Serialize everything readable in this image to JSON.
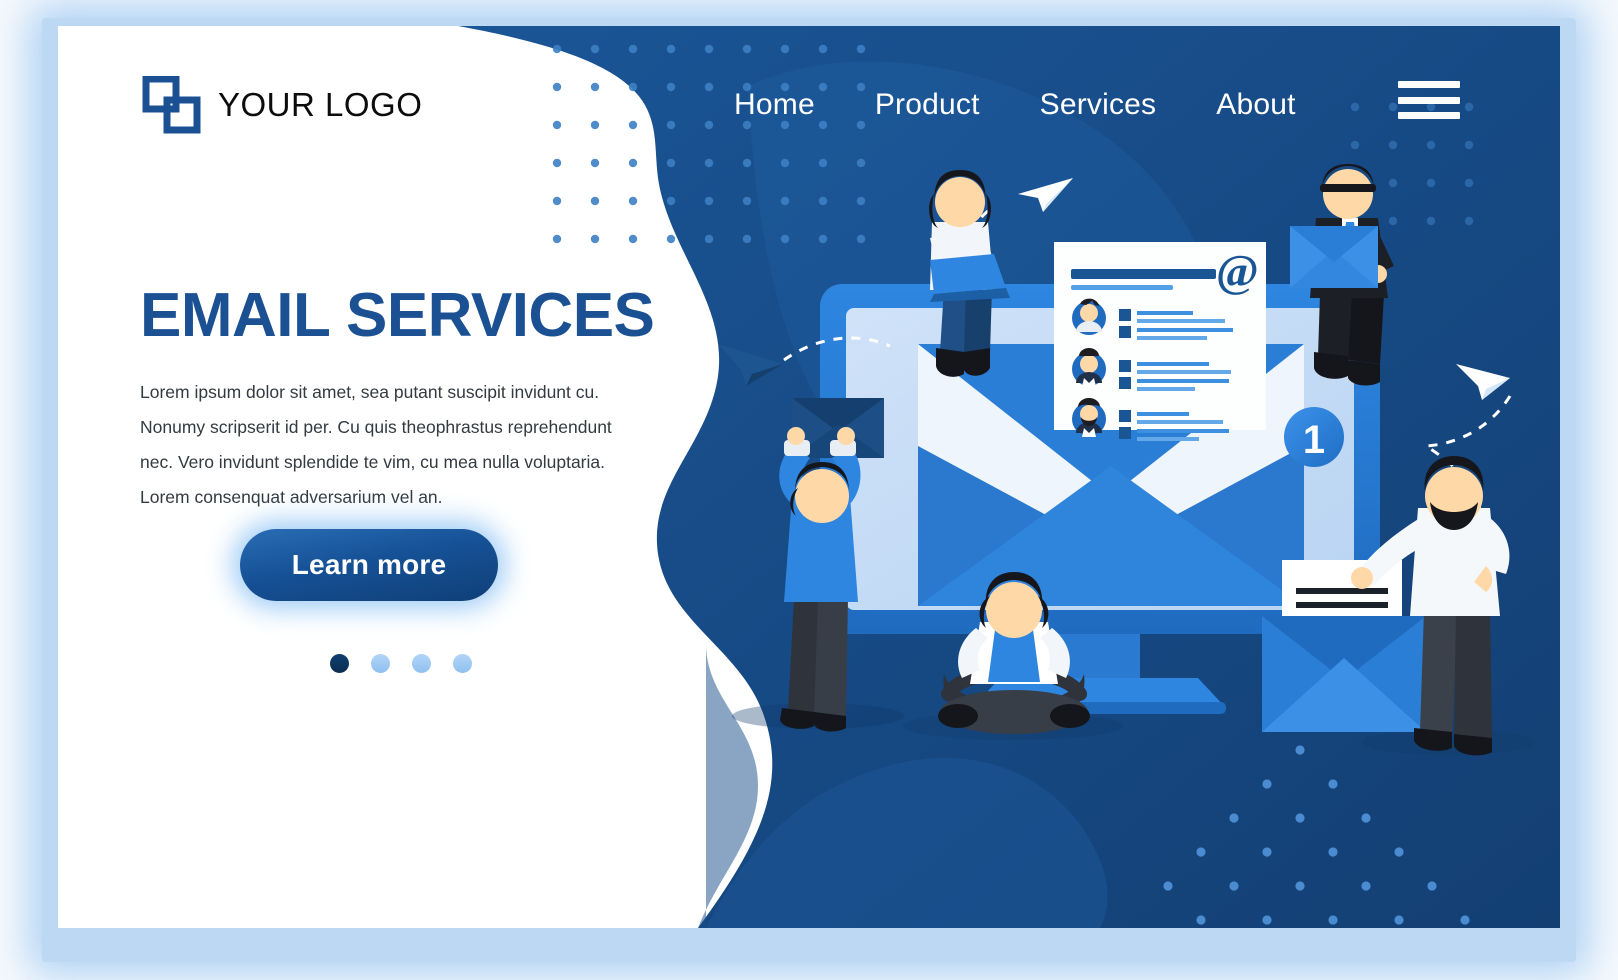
{
  "brand": {
    "logo_icon": "two-overlapping-squares-logo",
    "logo_text": "YOUR LOGO",
    "logo_color": "#1b5193"
  },
  "nav": {
    "items": [
      {
        "label": "Home"
      },
      {
        "label": "Product"
      },
      {
        "label": "Services"
      },
      {
        "label": "About"
      }
    ],
    "menu_icon": "hamburger-menu-icon",
    "link_color": "#ffffff"
  },
  "hero": {
    "title": "EMAIL SERVICES",
    "title_color": "#1b5193",
    "paragraph": "Lorem ipsum dolor sit amet, sea putant suscipit invidunt cu. Nonumy scripserit id per. Cu quis theophrastus reprehendunt nec. Vero invidunt splendide te vim, cu mea nulla voluptaria. Lorem consenquat adversarium vel an.",
    "cta_label": "Learn more",
    "cta_color": "#165196",
    "carousel": {
      "total": 4,
      "active_index": 0,
      "active_color": "#10406f",
      "inactive_color": "#a9d0f5"
    }
  },
  "illustration": {
    "notification_badge": "1",
    "at_symbol": "@",
    "monitor_icon": "desktop-monitor-icon",
    "envelope_icon": "envelope-icon",
    "paper_plane_icon": "paper-plane-icon",
    "characters": [
      {
        "name": "woman-with-laptop-sitting-on-monitor"
      },
      {
        "name": "man-in-suit-holding-envelope"
      },
      {
        "name": "man-lifting-envelope"
      },
      {
        "name": "man-sitting-crosslegged-with-laptop"
      },
      {
        "name": "bearded-man-with-letter"
      }
    ],
    "email_list_rows": 3
  },
  "theme": {
    "background": "#f5f9fd",
    "card_background": "#ffffff",
    "primary_blue": "#1b5193",
    "deep_blue": "#0f3b6b",
    "bright_blue": "#2e86e0",
    "light_blue": "#cfe4fa"
  }
}
